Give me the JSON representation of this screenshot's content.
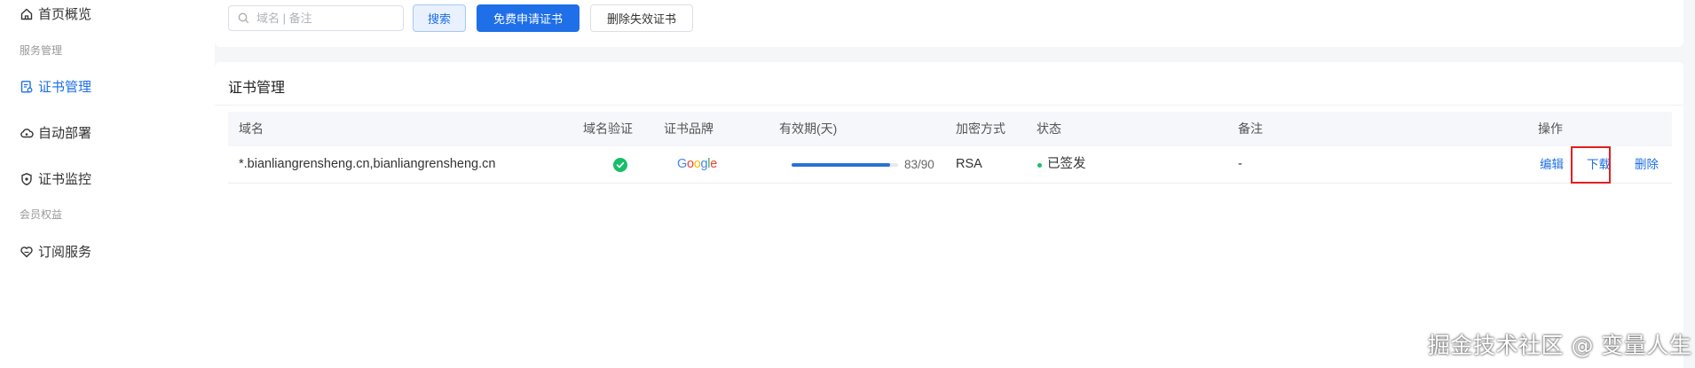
{
  "sidebar": {
    "items": [
      {
        "label": "首页概览",
        "icon": "home-icon"
      },
      {
        "group": "服务管理"
      },
      {
        "label": "证书管理",
        "icon": "certificate-icon",
        "active": true
      },
      {
        "label": "自动部署",
        "icon": "cloud-deploy-icon"
      },
      {
        "label": "证书监控",
        "icon": "shield-icon"
      },
      {
        "group": "会员权益"
      },
      {
        "label": "订阅服务",
        "icon": "heart-icon"
      }
    ]
  },
  "toolbar": {
    "search_placeholder": "域名 | 备注",
    "search_button": "搜索",
    "apply_button": "免费申请证书",
    "delete_invalid_button": "删除失效证书"
  },
  "list": {
    "title": "证书管理",
    "columns": [
      "域名",
      "域名验证",
      "证书品牌",
      "有效期(天)",
      "加密方式",
      "状态",
      "备注",
      "操作"
    ],
    "rows": [
      {
        "domain": "*.bianliangrensheng.cn,bianliangrensheng.cn",
        "verified": true,
        "brand": "Google",
        "validity_remaining": 83,
        "validity_total": 90,
        "validity_text": "83/90",
        "encryption": "RSA",
        "status": "已签发",
        "remark": "-",
        "actions": {
          "edit": "编辑",
          "download": "下载",
          "delete": "删除"
        }
      }
    ]
  },
  "watermark": "掘金技术社区 @ 变量人生",
  "colors": {
    "accent": "#1e6fe8",
    "success": "#19be6b",
    "highlight": "#e02020"
  }
}
